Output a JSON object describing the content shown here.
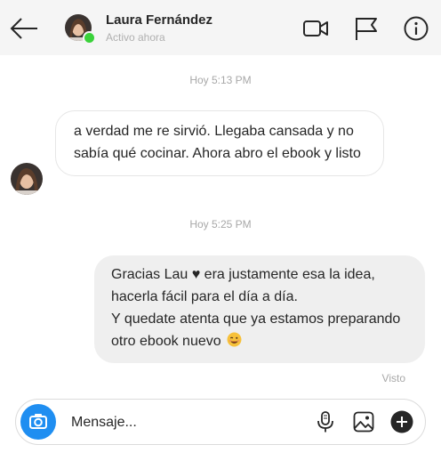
{
  "header": {
    "contact_name": "Laura Fernández",
    "status": "Activo ahora",
    "icons": [
      "back-arrow-icon",
      "video-call-icon",
      "flag-icon",
      "info-icon"
    ],
    "online_color": "#3ad23a"
  },
  "conversation": {
    "timestamp_1": "Hoy 5:13 PM",
    "incoming_message": "a verdad me re sirvió. Llegaba cansada y no sabía qué cocinar. Ahora abro el ebook y listo",
    "timestamp_2": "Hoy 5:25 PM",
    "outgoing_message": {
      "line1_before_heart": "Gracias Lau",
      "heart": "♥",
      "line1_after_heart": " era justamente esa la idea, hacerla fácil para el día a día.",
      "line2": "Y quedate atenta que ya estamos preparando otro ebook nuevo",
      "emoji": "winking-face"
    },
    "seen_label": "Visto"
  },
  "composer": {
    "placeholder": "Mensaje...",
    "camera_color": "#1f8ef1",
    "icons": [
      "camera-icon",
      "microphone-icon",
      "gallery-icon",
      "plus-icon"
    ]
  }
}
